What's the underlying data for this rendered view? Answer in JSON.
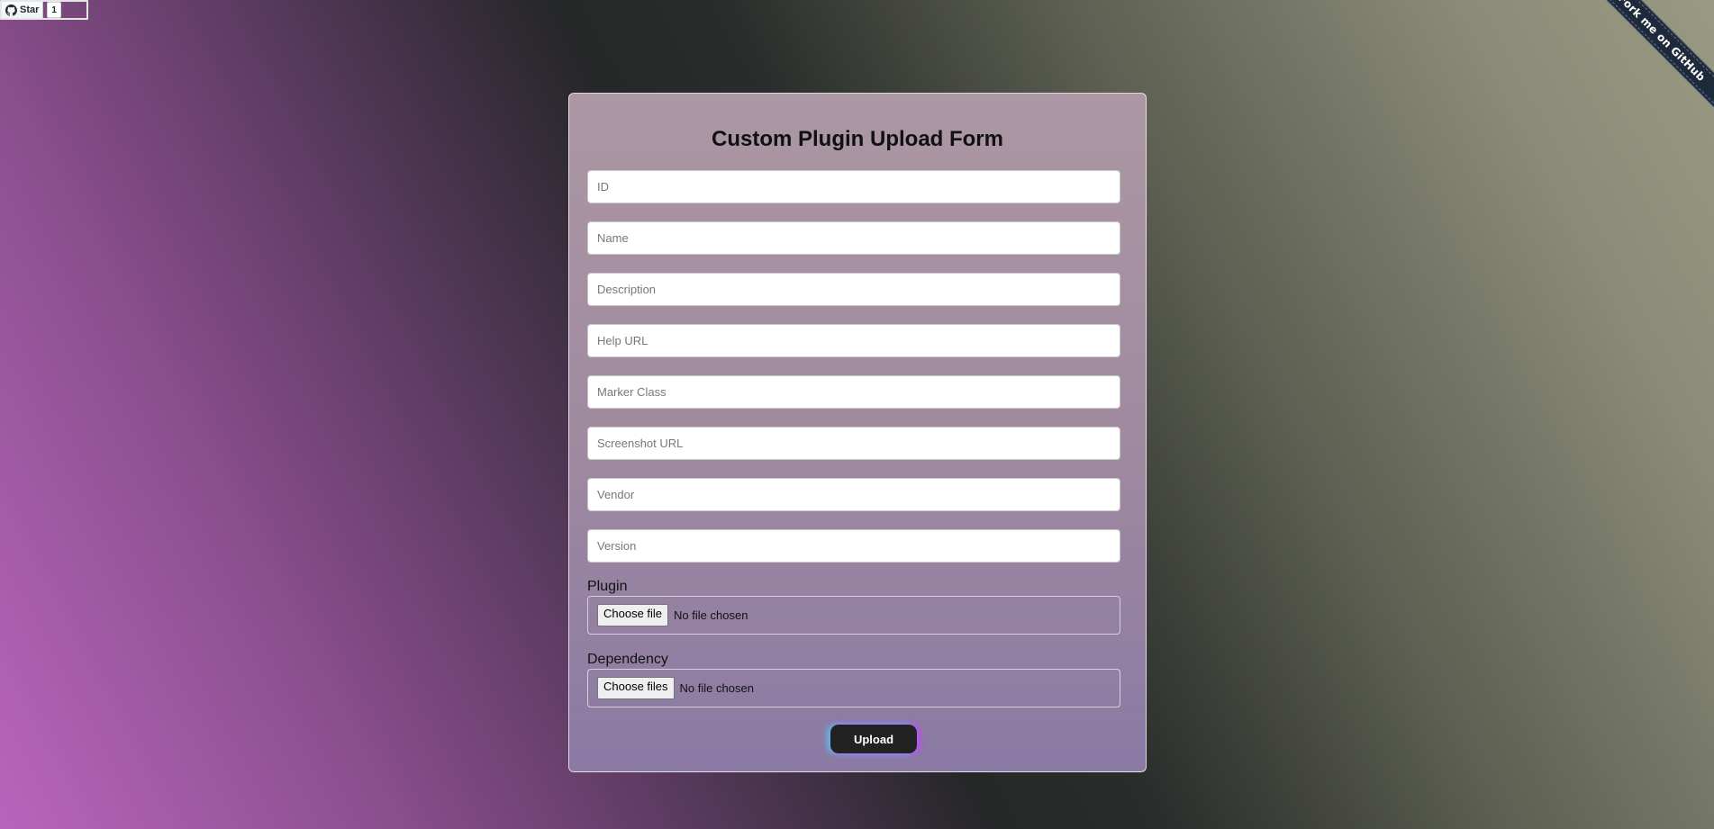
{
  "github_star": {
    "label": "Star",
    "count": "1",
    "icon": "github-icon"
  },
  "ribbon": {
    "text": "Fork me on GitHub"
  },
  "form": {
    "title": "Custom Plugin Upload Form",
    "fields": {
      "id": {
        "placeholder": "ID",
        "value": ""
      },
      "name": {
        "placeholder": "Name",
        "value": ""
      },
      "description": {
        "placeholder": "Description",
        "value": ""
      },
      "help_url": {
        "placeholder": "Help URL",
        "value": ""
      },
      "marker_class": {
        "placeholder": "Marker Class",
        "value": ""
      },
      "screenshot_url": {
        "placeholder": "Screenshot URL",
        "value": ""
      },
      "vendor": {
        "placeholder": "Vendor",
        "value": ""
      },
      "version": {
        "placeholder": "Version",
        "value": ""
      }
    },
    "plugin": {
      "label": "Plugin",
      "button": "Choose file",
      "status": "No file chosen"
    },
    "dependency": {
      "label": "Dependency",
      "button": "Choose files",
      "status": "No file chosen"
    },
    "upload_label": "Upload"
  },
  "colors": {
    "button_bg": "#222222",
    "glow_left": "#50dcff",
    "glow_right": "#d23cff"
  }
}
